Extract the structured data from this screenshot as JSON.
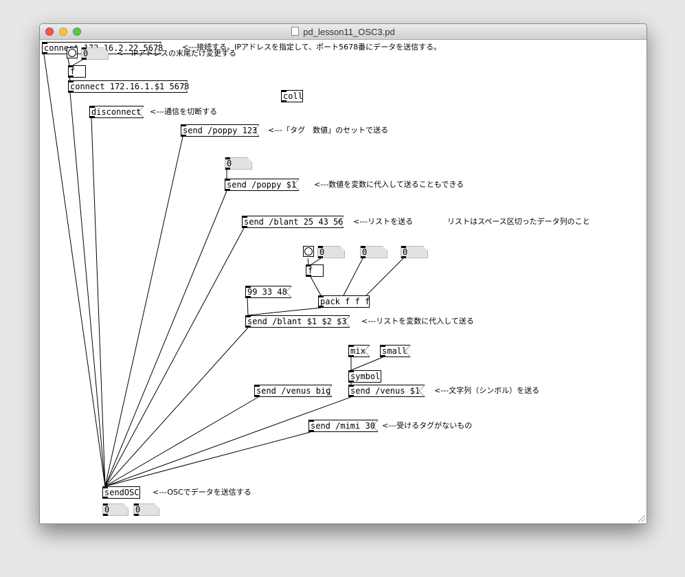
{
  "window": {
    "title": "pd_lesson11_OSC3.pd"
  },
  "objects": {
    "connect1": "connect 172.16.2.22 5678",
    "num_ip": "0",
    "f1": "f",
    "connect2": "connect 172.16.1.$1 5678",
    "coll": "coll",
    "disconnect": "disconnect",
    "send_poppy_123": "send /poppy 123",
    "num_poppy": "0",
    "send_poppy_var": "send /poppy $1",
    "send_blant_list": "send /blant 25 43 56",
    "num_a": "0",
    "num_b": "0",
    "num_c": "0",
    "f2": "f",
    "list_99": "99 33 48",
    "pack": "pack f f f",
    "send_blant_var": "send /blant $1 $2 $3",
    "mix": "mix",
    "small": "small",
    "symbol": "symbol",
    "send_venus_big": "send /venus big",
    "send_venus_var": "send /venus $1",
    "send_mimi": "send /mimi 30",
    "sendosc": "sendOSC",
    "out_num1": "0",
    "out_num2": "0"
  },
  "comments": {
    "c_connect": "<---接続する。IPアドレスを指定して、ポート5678番にデータを送信する。",
    "c_ip": "<---IPアドレスの末尾だけ変更する",
    "c_disconnect": "<---通信を切断する",
    "c_poppy": "<---「タグ　数値」のセットで送る",
    "c_poppy_var": "<---数値を変数に代入して送ることもできる",
    "c_list": "<---リストを送る",
    "c_list_note": "リストはスペース区切ったデータ列のこと",
    "c_list_var": "<---リストを変数に代入して送る",
    "c_symbol": "<---文字列（シンボル）を送る",
    "c_mimi": "<---受けるタグがないもの",
    "c_sendosc": "<---OSCでデータを送信する"
  },
  "icons": [
    "close-icon",
    "minimize-icon",
    "zoom-icon",
    "document-icon",
    "resize-grip-icon"
  ],
  "colors": {
    "close": "#ee5b52",
    "minimize": "#f5c23c",
    "zoom": "#62c34a"
  }
}
